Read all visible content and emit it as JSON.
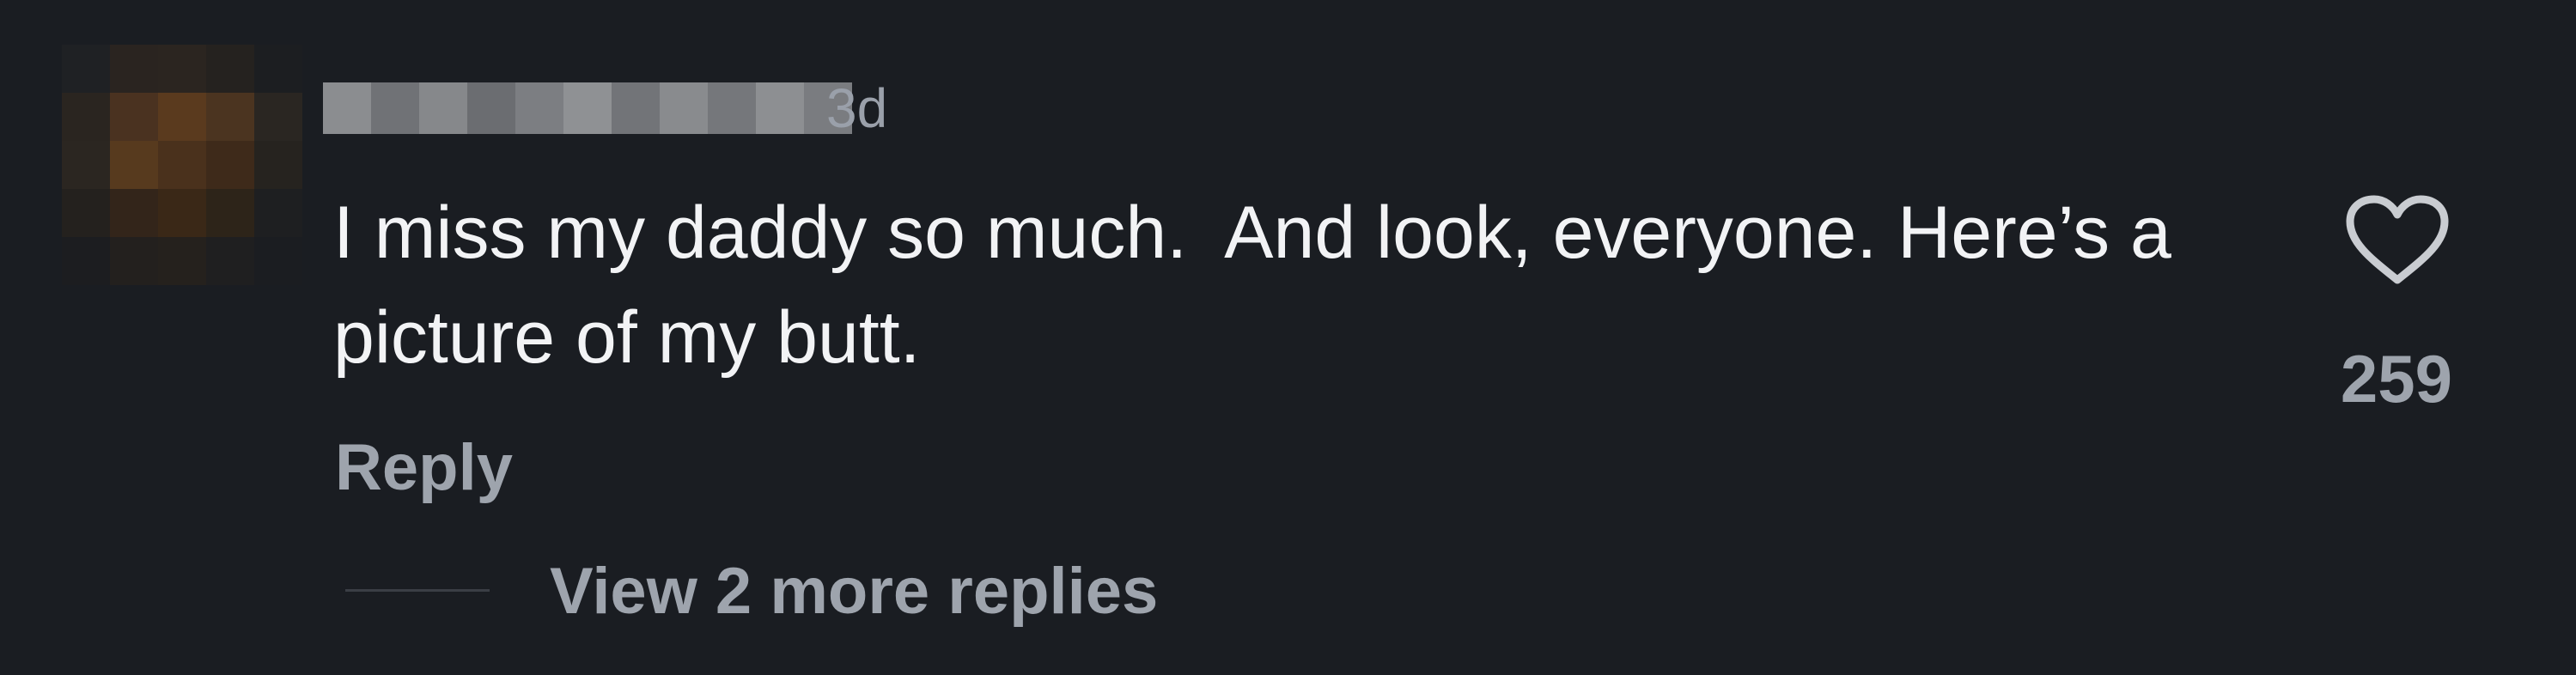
{
  "comment": {
    "timestamp": "3d",
    "text": "I miss my daddy so much.  And look, everyone. Here’s a picture of my butt.",
    "reply_label": "Reply",
    "view_replies_label": "View 2 more replies",
    "like_count": "259",
    "like_icon": "heart-outline-icon"
  },
  "colors": {
    "background": "#1a1d22",
    "primary_text": "#f2f3f5",
    "secondary_text": "#9ea4ad"
  }
}
